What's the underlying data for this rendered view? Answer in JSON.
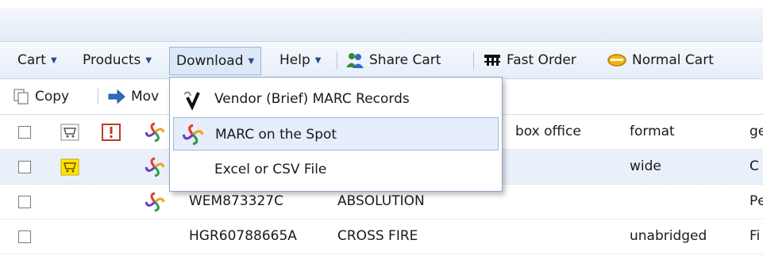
{
  "menubar": {
    "cart": "Cart",
    "products": "Products",
    "download": "Download",
    "help": "Help",
    "share_cart": "Share Cart",
    "fast_order": "Fast Order",
    "normal_cart": "Normal Cart"
  },
  "toolbar": {
    "copy": "Copy",
    "move": "Mov"
  },
  "dropdown": {
    "items": [
      {
        "label": "Vendor (Brief) MARC Records",
        "icon": "vendor-v-icon"
      },
      {
        "label": "MARC on the Spot",
        "icon": "marc-swirl-icon"
      },
      {
        "label": "Excel or CSV File",
        "icon": "blank-icon"
      }
    ]
  },
  "grid": {
    "headers": {
      "box_office": "box office",
      "format": "format",
      "genre": "gе"
    },
    "rows": [
      {
        "id": "",
        "title": "",
        "format": "wide",
        "genre": "C"
      },
      {
        "id": "WEM873327C",
        "title": "ABSOLUTION",
        "format": "",
        "genre": "Pе"
      },
      {
        "id": "HGR60788665A",
        "title": "CROSS FIRE",
        "format": "unabridged",
        "genre": "Fi"
      }
    ]
  },
  "colors": {
    "accent": "#274b8a",
    "menu_bg": "#e6eef8",
    "row_alt": "#e9f0fa",
    "highlight": "#e5eefa"
  }
}
